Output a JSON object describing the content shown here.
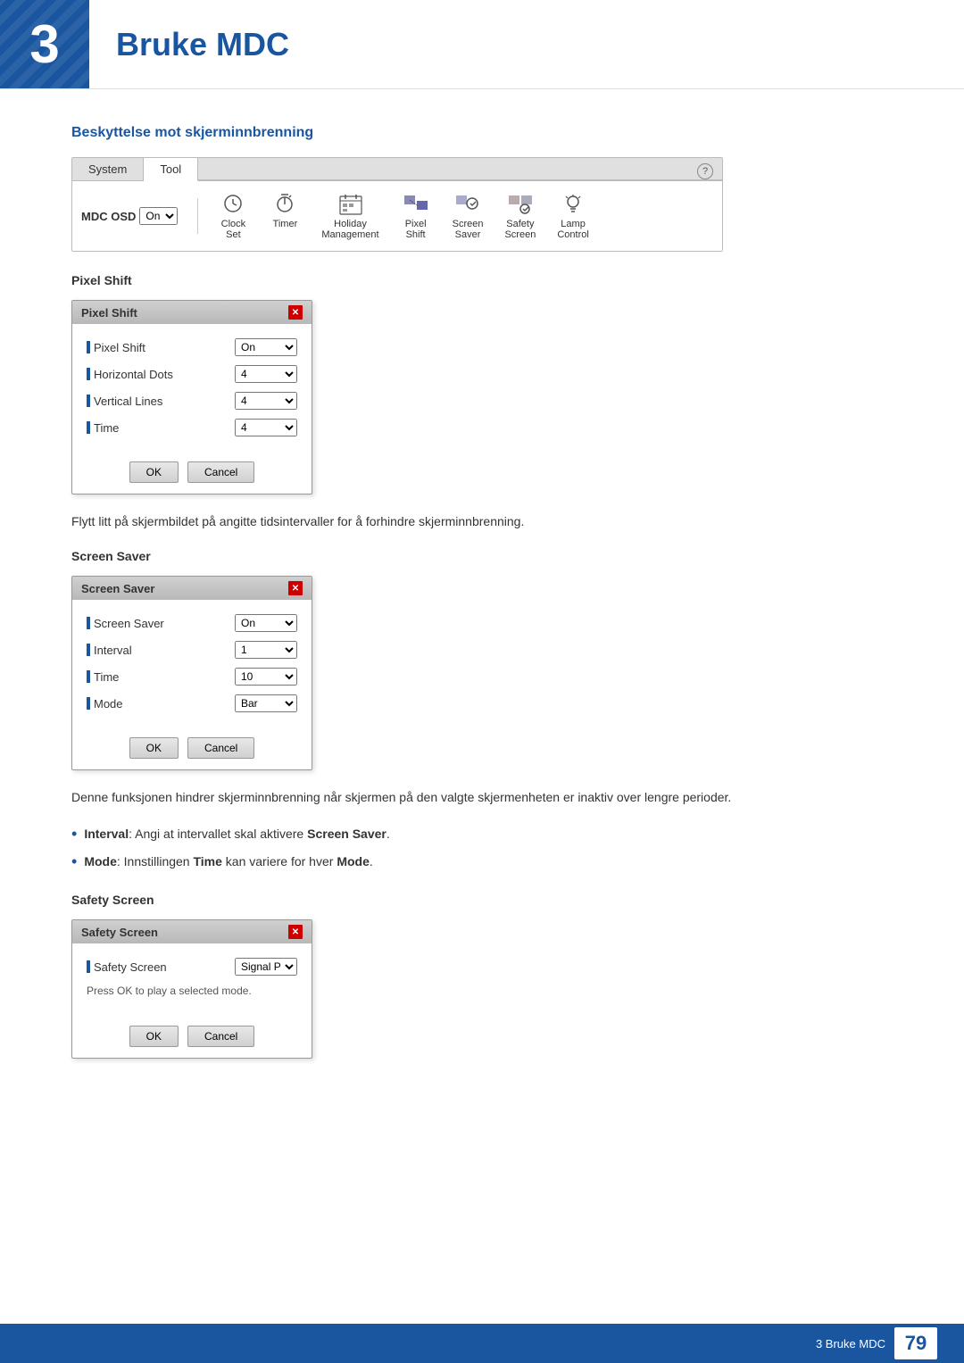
{
  "header": {
    "chapter_number": "3",
    "chapter_title": "Bruke MDC"
  },
  "section": {
    "heading": "Beskyttelse mot skjerminnbrenning"
  },
  "toolbar": {
    "help_label": "?",
    "tabs": [
      {
        "label": "System",
        "active": false
      },
      {
        "label": "Tool",
        "active": true
      }
    ],
    "mdc_osd_label": "MDC OSD",
    "mdc_osd_value": "On",
    "items": [
      {
        "id": "clock-set",
        "label1": "Clock",
        "label2": "Set"
      },
      {
        "id": "timer",
        "label1": "Timer",
        "label2": ""
      },
      {
        "id": "holiday-management",
        "label1": "Holiday",
        "label2": "Management"
      },
      {
        "id": "pixel-shift",
        "label1": "Pixel",
        "label2": "Shift"
      },
      {
        "id": "screen-saver",
        "label1": "Screen",
        "label2": "Saver"
      },
      {
        "id": "safety-screen",
        "label1": "Safety",
        "label2": "Screen"
      },
      {
        "id": "lamp-control",
        "label1": "Lamp",
        "label2": "Control"
      }
    ]
  },
  "pixel_shift_section": {
    "heading": "Pixel Shift",
    "dialog": {
      "title": "Pixel Shift",
      "rows": [
        {
          "label": "Pixel Shift",
          "value": "On",
          "type": "select"
        },
        {
          "label": "Horizontal Dots",
          "value": "4",
          "type": "select"
        },
        {
          "label": "Vertical Lines",
          "value": "4",
          "type": "select"
        },
        {
          "label": "Time",
          "value": "4",
          "type": "select"
        }
      ],
      "ok_label": "OK",
      "cancel_label": "Cancel"
    },
    "description": "Flytt litt på skjermbildet på angitte tidsintervaller for å forhindre skjerminnbrenning."
  },
  "screen_saver_section": {
    "heading": "Screen Saver",
    "dialog": {
      "title": "Screen Saver",
      "rows": [
        {
          "label": "Screen Saver",
          "value": "On",
          "type": "select"
        },
        {
          "label": "Interval",
          "value": "1",
          "type": "select"
        },
        {
          "label": "Time",
          "value": "10",
          "type": "select"
        },
        {
          "label": "Mode",
          "value": "Bar",
          "type": "select"
        }
      ],
      "ok_label": "OK",
      "cancel_label": "Cancel"
    },
    "description": "Denne funksjonen hindrer skjerminnbrenning når skjermen på den valgte skjermenheten er inaktiv over lengre perioder.",
    "bullets": [
      {
        "term": "Interval",
        "colon": ": Angi at intervallet skal aktivere ",
        "term2": "Screen Saver",
        "rest": "."
      },
      {
        "term": "Mode",
        "colon": ": Innstillingen ",
        "term2": "Time",
        "rest": " kan variere for hver ",
        "term3": "Mode",
        "rest2": "."
      }
    ]
  },
  "safety_screen_section": {
    "heading": "Safety Screen",
    "dialog": {
      "title": "Safety Screen",
      "rows": [
        {
          "label": "Safety Screen",
          "value": "Signal Patt...",
          "type": "select"
        }
      ],
      "note": "Press OK to play a selected mode.",
      "ok_label": "OK",
      "cancel_label": "Cancel"
    }
  },
  "footer": {
    "chapter_label": "3 Bruke MDC",
    "page_number": "79"
  }
}
